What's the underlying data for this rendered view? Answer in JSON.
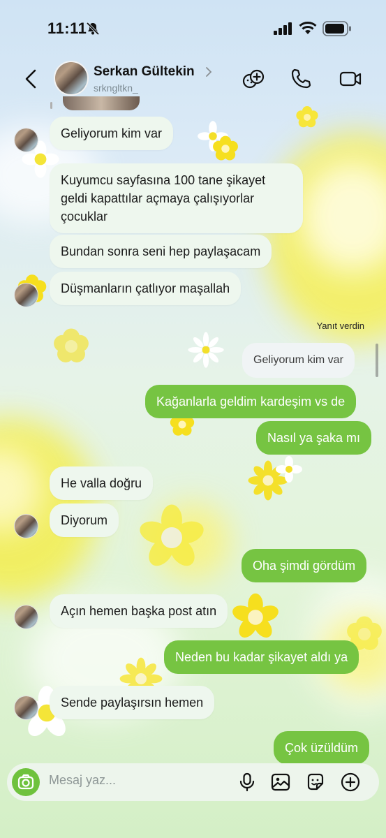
{
  "status": {
    "time": "11:11"
  },
  "header": {
    "name": "Serkan Gültekin",
    "handle": "srkngltkn_"
  },
  "reply_label": "Yanıt verdin",
  "messages": [
    {
      "text": "Geliyorum kim var"
    },
    {
      "text": "Kuyumcu sayfasına 100 tane şikayet"
    },
    {
      "text": "geldi kapattılar açmaya çalışıyorlar"
    },
    {
      "text": "çocuklar"
    },
    {
      "text": "Bundan sonra seni hep paylaşacam"
    },
    {
      "text": "Düşmanların çatlıyor maşallah"
    },
    {
      "text": "Geliyorum kim var"
    },
    {
      "text": "Kağanlarla geldim kardeşim vs de"
    },
    {
      "text": "Nasıl ya şaka mı"
    },
    {
      "text": "He valla doğru"
    },
    {
      "text": "Diyorum"
    },
    {
      "text": "Oha şimdi gördüm"
    },
    {
      "text": "Açın hemen başka post atın"
    },
    {
      "text": "Neden bu kadar şikayet aldı ya"
    },
    {
      "text": "Sende paylaşırsın hemen"
    },
    {
      "text": "Çok üzüldüm"
    }
  ],
  "composer": {
    "placeholder": "Mesaj yaz..."
  },
  "colors": {
    "outgoing": "#76c442",
    "incoming": "#eef7ee",
    "accent": "#6fc23d"
  },
  "icons": [
    "bell-slash-icon",
    "signal-icon",
    "wifi-icon",
    "battery-icon",
    "back-icon",
    "chevron-right-icon",
    "sticker-plus-icon",
    "phone-icon",
    "video-icon",
    "camera-icon",
    "microphone-icon",
    "image-icon",
    "sticker-icon",
    "plus-icon"
  ]
}
